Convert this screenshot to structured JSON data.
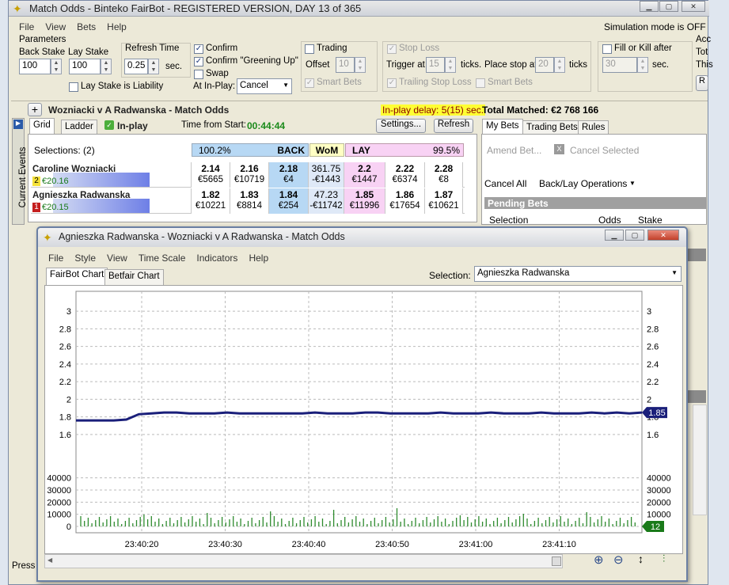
{
  "main": {
    "title": "Match Odds - Binteko FairBot - REGISTERED VERSION, DAY 13 of 365",
    "menu": [
      "File",
      "View",
      "Bets",
      "Help"
    ],
    "simulation": "Simulation mode is OFF"
  },
  "params": {
    "heading": "Parameters",
    "back_stake_label": "Back Stake",
    "back_stake": "100",
    "lay_stake_label": "Lay Stake",
    "lay_stake": "100",
    "refresh_label": "Refresh Time",
    "refresh": "0.25",
    "sec": "sec.",
    "lay_liab": "Lay Stake is Liability",
    "confirm": "Confirm",
    "confirm_green": "Confirm \"Greening Up\"",
    "swap": "Swap",
    "inplay_label": "At In-Play:",
    "inplay_value": "Cancel",
    "trading": "Trading",
    "offset_label": "Offset",
    "offset": "10",
    "smart_bets": "Smart Bets",
    "stop_loss": "Stop Loss",
    "trigger_label": "Trigger at",
    "trigger": "15",
    "ticks": "ticks.",
    "place_stop": "Place stop at",
    "place_val": "20",
    "ticks2": "ticks",
    "trailing": "Trailing Stop Loss",
    "smart_bets2": "Smart Bets",
    "fok": "Fill or Kill after",
    "fok_val": "30",
    "sec2": "sec.",
    "cut1": "Acc",
    "cut2": "Tot",
    "cut3": "This"
  },
  "market": {
    "name": "Wozniacki v A Radwanska - Match Odds",
    "inplay_delay": "In-play delay: 5(15) sec.",
    "total_matched": "Total Matched: €2 768 166",
    "plus": "+",
    "tab_grid": "Grid",
    "tab_ladder": "Ladder",
    "inplay": "In-play",
    "time_label": "Time from Start:",
    "time": "00:44:44",
    "settings": "Settings...",
    "refresh": "Refresh",
    "side": "Current Events"
  },
  "grid": {
    "selections": "Selections: (2)",
    "back_pct": "100.2%",
    "back": "BACK",
    "wom": "WoM",
    "lay": "LAY",
    "lay_pct": "99.5%",
    "rows": [
      {
        "name": "Caroline Wozniacki",
        "num": "2",
        "pl": "€20.16",
        "cells": [
          [
            "2.14",
            "€5665"
          ],
          [
            "2.16",
            "€10719"
          ],
          [
            "2.18",
            "€4"
          ],
          [
            "361.75",
            "-€1443"
          ],
          [
            "2.2",
            "€1447"
          ],
          [
            "2.22",
            "€6374"
          ],
          [
            "2.28",
            "€8"
          ]
        ]
      },
      {
        "name": "Agnieszka Radwanska",
        "num": "1",
        "pl": "€20.15",
        "cells": [
          [
            "1.82",
            "€10221"
          ],
          [
            "1.83",
            "€8814"
          ],
          [
            "1.84",
            "€254"
          ],
          [
            "47.23",
            "-€11742"
          ],
          [
            "1.85",
            "€11996"
          ],
          [
            "1.86",
            "€17654"
          ],
          [
            "1.87",
            "€10621"
          ]
        ]
      }
    ]
  },
  "bets": {
    "tabs": [
      "My Bets",
      "Trading Bets",
      "Rules"
    ],
    "amend": "Amend Bet...",
    "cancel_sel": "Cancel Selected",
    "cancel_all": "Cancel All",
    "backlay": "Back/Lay Operations",
    "pending": "Pending Bets",
    "col_sel": "Selection",
    "col_odds": "Odds",
    "col_stake": "Stake"
  },
  "status": "Press",
  "chart": {
    "title": "Agnieszka Radwanska - Wozniacki v A Radwanska - Match Odds",
    "menu": [
      "File",
      "Style",
      "View",
      "Time Scale",
      "Indicators",
      "Help"
    ],
    "tab1": "FairBot Chart",
    "tab2": "Betfair Chart",
    "sel_label": "Selection:",
    "sel_value": "Agnieszka Radwanska"
  },
  "chart_data": {
    "type": "line",
    "price_axis": [
      3,
      2.8,
      2.6,
      2.4,
      2.2,
      2,
      1.8,
      1.6
    ],
    "volume_axis": [
      40000,
      30000,
      20000,
      10000,
      0
    ],
    "x_ticks": [
      "23:40:20",
      "23:40:30",
      "23:40:40",
      "23:40:50",
      "23:41:00",
      "23:41:10"
    ],
    "series": [
      {
        "values": [
          1.76,
          1.76,
          1.76,
          1.76,
          1.77,
          1.83,
          1.84,
          1.85,
          1.85,
          1.84,
          1.84,
          1.84,
          1.85,
          1.84,
          1.84,
          1.84,
          1.84,
          1.84,
          1.84,
          1.85,
          1.84,
          1.84,
          1.84,
          1.85,
          1.85,
          1.84,
          1.84,
          1.84,
          1.84,
          1.85,
          1.84,
          1.84,
          1.84,
          1.85,
          1.84,
          1.84,
          1.84,
          1.85,
          1.84,
          1.84,
          1.84,
          1.85,
          1.84,
          1.85,
          1.84,
          1.85
        ]
      }
    ],
    "last_price": "1.85",
    "last_volume": "12",
    "line_color": "#1a1f7a",
    "volume_color": "#2e8b2e"
  }
}
